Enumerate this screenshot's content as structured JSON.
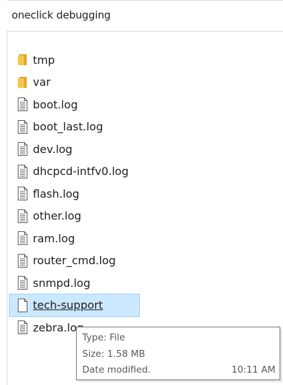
{
  "header": {
    "title": "oneclick debugging"
  },
  "items": [
    {
      "label": "tmp",
      "icon": "folder-icon",
      "type": "folder"
    },
    {
      "label": "var",
      "icon": "folder-icon",
      "type": "folder"
    },
    {
      "label": "boot.log",
      "icon": "text-file-icon",
      "type": "file"
    },
    {
      "label": "boot_last.log",
      "icon": "text-file-icon",
      "type": "file"
    },
    {
      "label": "dev.log",
      "icon": "text-file-icon",
      "type": "file"
    },
    {
      "label": "dhcpcd-intfv0.log",
      "icon": "text-file-icon",
      "type": "file"
    },
    {
      "label": "flash.log",
      "icon": "text-file-icon",
      "type": "file"
    },
    {
      "label": "other.log",
      "icon": "text-file-icon",
      "type": "file"
    },
    {
      "label": "ram.log",
      "icon": "text-file-icon",
      "type": "file"
    },
    {
      "label": "router_cmd.log",
      "icon": "text-file-icon",
      "type": "file"
    },
    {
      "label": "snmpd.log",
      "icon": "text-file-icon",
      "type": "file"
    },
    {
      "label": "tech-support",
      "icon": "blank-file-icon",
      "type": "file",
      "selected": true
    },
    {
      "label": "zebra.log",
      "icon": "text-file-icon",
      "type": "file"
    }
  ],
  "tooltip": {
    "type_line": "Type: File",
    "size_line": "Size: 1.58 MB",
    "date_label": "Date modified.",
    "date_value": "10:11 AM"
  },
  "colors": {
    "folder": "#f2c94c",
    "selection_fill": "#cce8ff",
    "selection_border": "#99d1ff"
  }
}
